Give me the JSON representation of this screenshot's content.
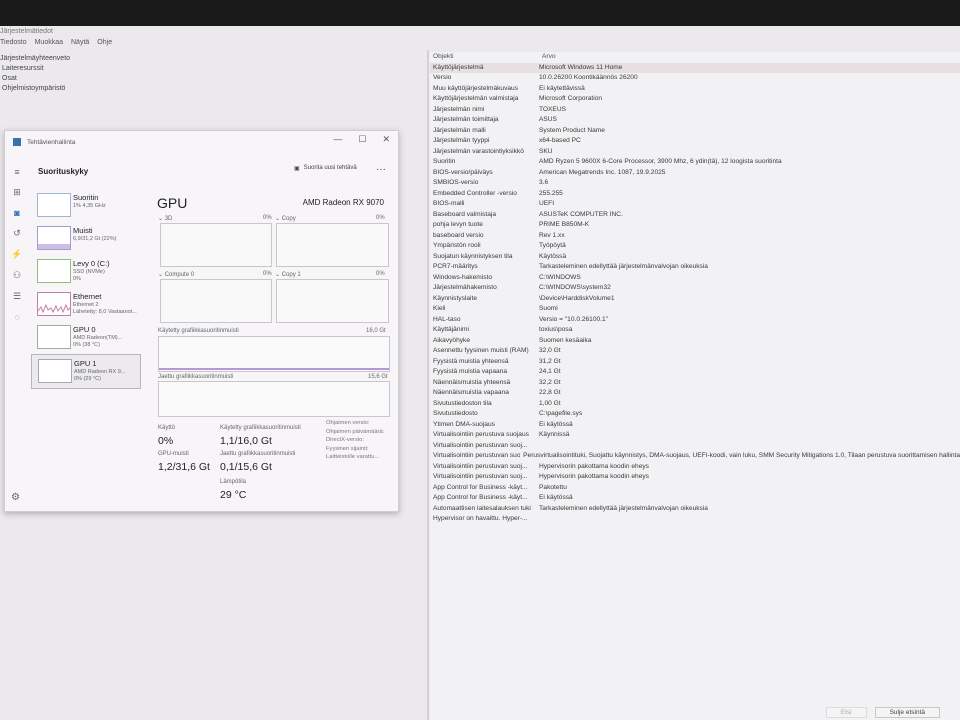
{
  "msinfo": {
    "title": "Järjestelmätiedot",
    "menu": [
      "Tiedosto",
      "Muokkaa",
      "Näytä",
      "Ohje"
    ],
    "tree": [
      "Järjestelmäyhteenveto",
      "Laiteresurssit",
      "Osat",
      "Ohjelmistoympäristö"
    ],
    "columns": {
      "key": "Objekti",
      "value": "Arvo"
    },
    "rows": [
      [
        "Käyttöjärjestelmä",
        "Microsoft Windows 11 Home"
      ],
      [
        "Versio",
        "10.0.26200 Koontikäännös 26200"
      ],
      [
        "Muu käyttöjärjestelmäkuvaus",
        "Ei käytettävissä"
      ],
      [
        "Käyttöjärjestelmän valmistaja",
        "Microsoft Corporation"
      ],
      [
        "Järjestelmän nimi",
        "TOXEUS"
      ],
      [
        "Järjestelmän toimittaja",
        "ASUS"
      ],
      [
        "Järjestelmän malli",
        "System Product Name"
      ],
      [
        "Järjestelmän tyyppi",
        "x64-based PC"
      ],
      [
        "Järjestelmän varastointiyksikkö",
        "SKU"
      ],
      [
        "Suoritin",
        "AMD Ryzen 5 9600X 6-Core Processor, 3900 Mhz, 6 ydin(tä), 12 loogista suoritinta"
      ],
      [
        "BIOS-versio/päiväys",
        "American Megatrends Inc. 1087, 19.9.2025"
      ],
      [
        "SMBIOS-versio",
        "3.6"
      ],
      [
        "Embedded Controller -versio",
        "255.255"
      ],
      [
        "BIOS-malli",
        "UEFI"
      ],
      [
        "Baseboard valmistaja",
        "ASUSTeK COMPUTER INC."
      ],
      [
        "pohja levyn tuote",
        "PRIME B850M-K"
      ],
      [
        "baseboard versio",
        "Rev 1.xx"
      ],
      [
        "Ympäristön rooli",
        "Työpöytä"
      ],
      [
        "Suojatun käynnistyksen tila",
        "Käytössä"
      ],
      [
        "PCR7-määritys",
        "Tarkasteleminen edellyttää järjestelmänvalvojan oikeuksia"
      ],
      [
        "Windows-hakemisto",
        "C:\\WINDOWS"
      ],
      [
        "Järjestelmähakemisto",
        "C:\\WINDOWS\\system32"
      ],
      [
        "Käynnistyslaite",
        "\\Device\\HarddiskVolume1"
      ],
      [
        "Kieli",
        "Suomi"
      ],
      [
        "HAL-taso",
        "Versio = \"10.0.26100.1\""
      ],
      [
        "Käyttäjänimi",
        "toxius\\posa"
      ],
      [
        "Aikavyöhyke",
        "Suomen kesäaika"
      ],
      [
        "Asennettu fyysinen muisti (RAM)",
        "32,0 Gt"
      ],
      [
        "Fyysistä muistia yhteensä",
        "31,2 Gt"
      ],
      [
        "Fyysistä muistia vapaana",
        "24,1 Gt"
      ],
      [
        "Näennäismuistia yhteensä",
        "32,2 Gt"
      ],
      [
        "Näennäismuistia vapaana",
        "22,8 Gt"
      ],
      [
        "Sivutustiedoston tila",
        "1,00 Gt"
      ],
      [
        "Sivutustiedosto",
        "C:\\pagefile.sys"
      ],
      [
        "Ytimen DMA-suojaus",
        "Ei käytössä"
      ],
      [
        "Virtualisointiin perustuva suojaus",
        "Käynnissä"
      ],
      [
        "Virtualisointiin perustuvan suoj...",
        ""
      ],
      [
        "Virtualisointiin perustuvan suoj...",
        "Perusvirtualisointituki, Suojattu käynnistys, DMA-suojaus, UEFI-koodi, vain luku, SMM Security Mitigations 1.0, Tilaan perustuva suorittamisen hallinta"
      ],
      [
        "Virtualisointiin perustuvan suoj...",
        "Hypervisorin pakottama koodin eheys"
      ],
      [
        "Virtualisointiin perustuvan suoj...",
        "Hypervisorin pakottama koodin eheys"
      ],
      [
        "App Control for Business -käyt...",
        "Pakotettu"
      ],
      [
        "App Control for Business -käyt...",
        "Ei käytössä"
      ],
      [
        "Automaattisen laitesalauksen tuki",
        "Tarkasteleminen edellyttää järjestelmänvalvojan oikeuksia"
      ],
      [
        "Hypervisor on havaittu. Hyper-...",
        ""
      ]
    ],
    "buttons": {
      "find": "Etsi",
      "close_find": "Sulje etsintä"
    }
  },
  "taskmgr": {
    "title": "Tehtävienhallinta",
    "controls": {
      "min": "—",
      "max": "☐",
      "close": "✕"
    },
    "heading": "Suorituskyky",
    "run_task": "Suorita uusi tehtävä",
    "more": "···",
    "devices": [
      {
        "name": "Suoritin",
        "sub": [
          "1% 4,35 GHz"
        ],
        "kind": "cpu"
      },
      {
        "name": "Muisti",
        "sub": [
          "6,9/31,2 Gt (22%)"
        ],
        "kind": "mem"
      },
      {
        "name": "Levy 0 (C:)",
        "sub": [
          "SSD (NVMe)",
          "0%"
        ],
        "kind": "disk"
      },
      {
        "name": "Ethernet",
        "sub": [
          "Ethernet 2",
          "Lähetetty: 8,0 Vastaanot..."
        ],
        "kind": "net"
      },
      {
        "name": "GPU 0",
        "sub": [
          "AMD Radeon(TM)...",
          "0% (38 °C)"
        ],
        "kind": "gpu"
      },
      {
        "name": "GPU 1",
        "sub": [
          "AMD Radeon RX 9...",
          "0% (29 °C)"
        ],
        "kind": "gpu"
      }
    ],
    "selected_device": 5,
    "gpu": {
      "title": "GPU",
      "name": "AMD Radeon RX 9070",
      "engines": [
        {
          "name": "3D",
          "pct": "0%"
        },
        {
          "name": "Copy",
          "pct": "0%"
        },
        {
          "name": "Compute 0",
          "pct": "0%"
        },
        {
          "name": "Copy 1",
          "pct": "0%"
        }
      ],
      "dedicated_label": "Käytetty grafiikkasuoritinmuisti",
      "dedicated_max": "16,0 Gt",
      "shared_label": "Jaettu grafiikkasuoritinmuisti",
      "shared_max": "15,6 Gt",
      "stats": {
        "util_label": "Käyttö",
        "util": "0%",
        "ded_label": "Käytetty grafiikkasuoritinmuisti",
        "ded": "1,1/16,0 Gt",
        "gpumem_label": "GPU-muisti",
        "gpumem": "1,2/31,6 Gt",
        "shared_label": "Jaettu grafiikkasuoritinmuisti",
        "shared": "0,1/15,6 Gt",
        "temp_label": "Lämpötila",
        "temp": "29 °C"
      },
      "info_lines": [
        "Ohjaimen versio:",
        "Ohjaimen päivämäärä:",
        "DirectX-versio:",
        "Fyysinen sijainti:",
        "Laitteistolle varattu..."
      ]
    }
  }
}
